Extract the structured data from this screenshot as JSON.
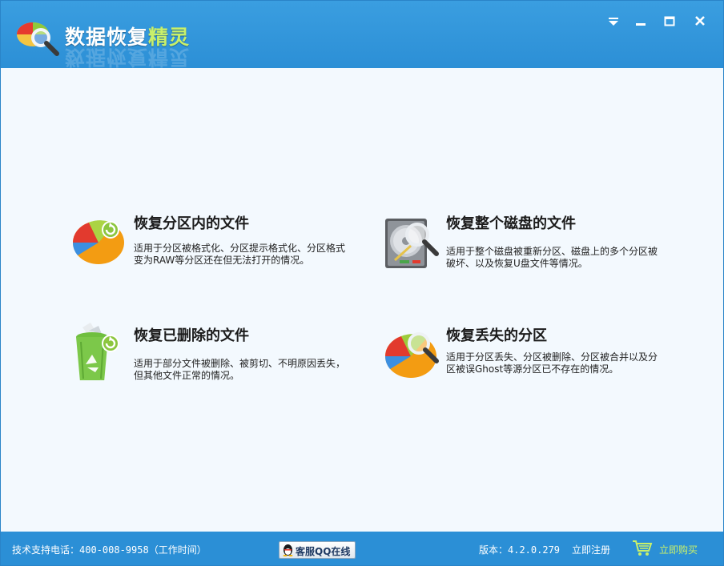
{
  "window": {
    "title_main": "数据恢复",
    "title_accent": "精灵",
    "controls": [
      "menu",
      "minimize",
      "maximize",
      "close"
    ]
  },
  "cards": [
    {
      "title": "恢复分区内的文件",
      "desc": "适用于分区被格式化、分区提示格式化、分区格式变为RAW等分区还在但无法打开的情况。",
      "icon": "pie-chart-recover-icon"
    },
    {
      "title": "恢复整个磁盘的文件",
      "desc": "适用于整个磁盘被重新分区、磁盘上的多个分区被破坏、以及恢复U盘文件等情况。",
      "icon": "hard-disk-magnifier-icon"
    },
    {
      "title": "恢复已删除的文件",
      "desc": "适用于部分文件被删除、被剪切、不明原因丢失，但其他文件正常的情况。",
      "icon": "recycle-bin-recover-icon"
    },
    {
      "title": "恢复丢失的分区",
      "desc": "适用于分区丢失、分区被删除、分区被合并以及分区被误Ghost等源分区已不存在的情况。",
      "icon": "pie-chart-magnifier-icon"
    }
  ],
  "statusbar": {
    "support": "技术支持电话：400-008-9958（工作时间）",
    "qq_label": "客服QQ在线",
    "version": "版本：4.2.0.279",
    "register": "立即注册",
    "buy": "立即购买"
  },
  "colors": {
    "titlebar": "#2c8fd6",
    "statusbar": "#2b8fd6",
    "accent_green": "#c9f06a",
    "background": "#f3f9fe"
  }
}
